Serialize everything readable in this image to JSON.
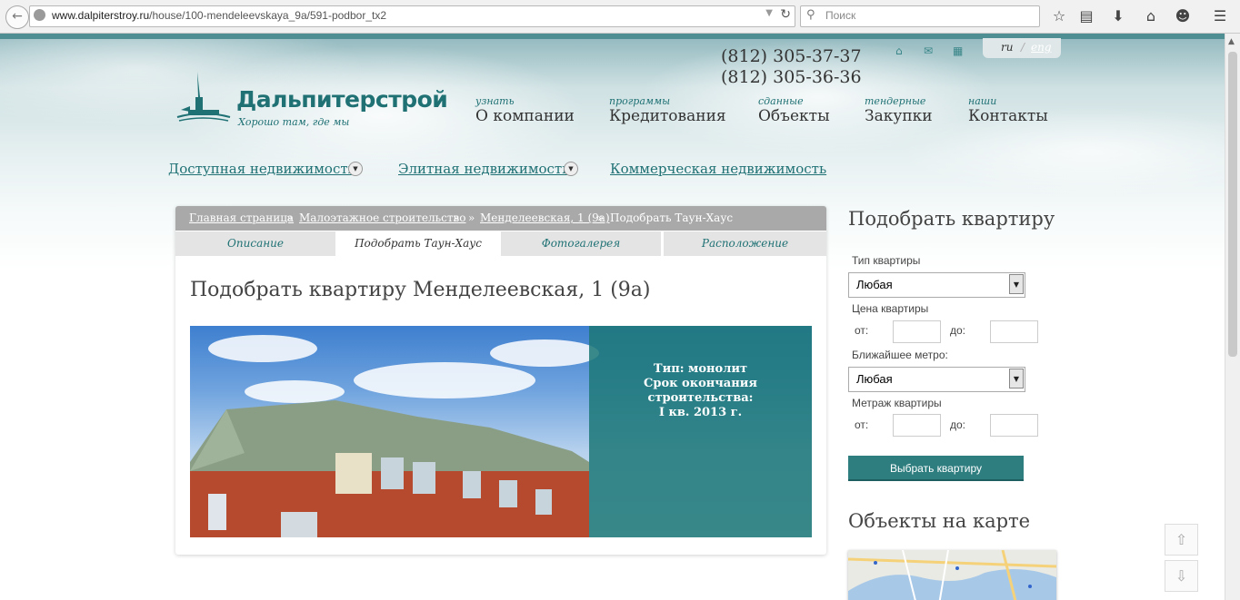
{
  "browser": {
    "url_host": "www.dalpiterstroy.ru",
    "url_path": "/house/100-mendeleevskaya_9a/591-podbor_tx2",
    "search_placeholder": "Поиск"
  },
  "header": {
    "phones": [
      "(812) 305-37-37",
      "(812) 305-36-36"
    ],
    "lang_ru": "ru",
    "lang_sep": "/",
    "lang_en": "eng",
    "logo_title": "Дальпитерстрой",
    "logo_subtitle": "Хорошо там, где мы",
    "menu": [
      {
        "small": "узнать",
        "big": "О компании"
      },
      {
        "small": "программы",
        "big": "Кредитования"
      },
      {
        "small": "сданные",
        "big": "Объекты"
      },
      {
        "small": "тендерные",
        "big": "Закупки"
      },
      {
        "small": "наши",
        "big": "Контакты"
      }
    ],
    "subnav": [
      "Доступная недвижимость",
      "Элитная недвижимость",
      "Коммерческая недвижимость"
    ]
  },
  "content": {
    "breadcrumbs": {
      "home": "Главная страница",
      "sep": "»",
      "lowrise": "Малоэтажное строительство",
      "sep2": "»",
      "sep3": "»",
      "house": "Менделеевская, 1 (9а)",
      "sep4": "»",
      "current": "Подобрать Таун-Хаус"
    },
    "tabs": [
      "Описание",
      "Подобрать Таун-Хаус",
      "Фотогалерея",
      "Расположение"
    ],
    "title": "Подобрать квартиру Менделеевская, 1 (9а)",
    "overlay_lines": [
      "Тип: монолит",
      "Срок окончания строительства:",
      "I кв. 2013 г."
    ]
  },
  "sidebar": {
    "title": "Подобрать квартиру",
    "type_label": "Тип квартиры",
    "type_value": "Любая",
    "price_label": "Цена квартиры",
    "from": "от:",
    "to": "до:",
    "metro_label": "Ближайшее метро:",
    "metro_value": "Любая",
    "area_label": "Метраж квартиры",
    "button": "Выбрать квартиру",
    "map_title": "Объекты на карте"
  }
}
